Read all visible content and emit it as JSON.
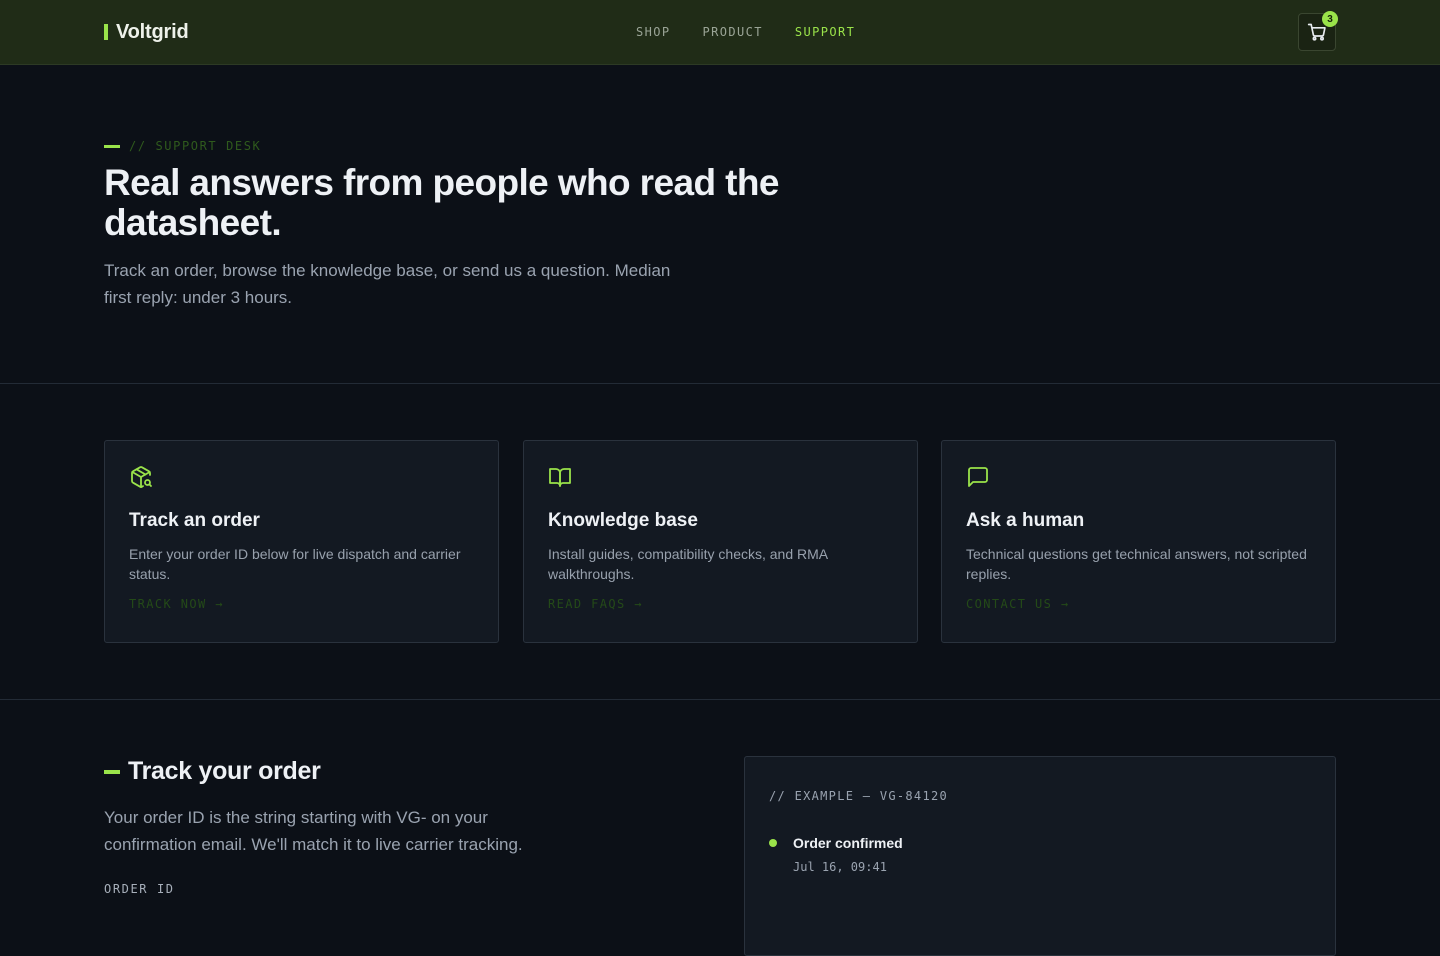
{
  "header": {
    "logo_text": "Voltgrid",
    "nav": [
      {
        "label": "SHOP",
        "active": false
      },
      {
        "label": "PRODUCT",
        "active": false
      },
      {
        "label": "SUPPORT",
        "active": true
      }
    ],
    "cart_count": "3"
  },
  "hero": {
    "eyebrow": "// SUPPORT DESK",
    "title": "Real answers from people who read the datasheet.",
    "subtitle": "Track an order, browse the knowledge base, or send us a question. Median first reply: under 3 hours."
  },
  "cards": [
    {
      "icon": "package-search-icon",
      "title": "Track an order",
      "text": "Enter your order ID below for live dispatch and carrier status.",
      "link": "TRACK NOW →"
    },
    {
      "icon": "book-open-icon",
      "title": "Knowledge base",
      "text": "Install guides, compatibility checks, and RMA walkthroughs.",
      "link": "READ FAQS →"
    },
    {
      "icon": "message-square-icon",
      "title": "Ask a human",
      "text": "Technical questions get technical answers, not scripted replies.",
      "link": "CONTACT US →"
    }
  ],
  "track": {
    "title": "Track your order",
    "description": "Your order ID is the string starting with VG- on your confirmation email. We'll match it to live carrier tracking.",
    "order_label": "ORDER ID",
    "example_heading": "// EXAMPLE — VG-84120",
    "steps": [
      {
        "title": "Order confirmed",
        "time": "Jul 16, 09:41"
      }
    ]
  },
  "colors": {
    "accent": "#9ae34a",
    "background": "#0c1017",
    "header_bg": "#202c17",
    "card_bg": "#131922"
  }
}
